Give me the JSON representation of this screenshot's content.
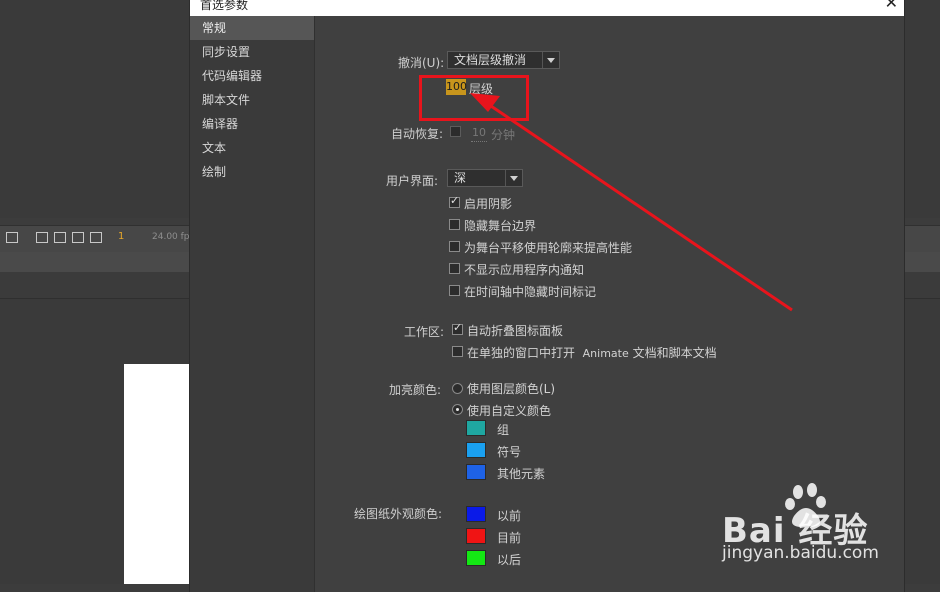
{
  "background_app": {
    "frame_number": "1",
    "fps": "24.00 fps"
  },
  "dialog": {
    "title": "首选参数",
    "sidebar": {
      "items": [
        {
          "label": "常规",
          "active": true
        },
        {
          "label": "同步设置"
        },
        {
          "label": "代码编辑器"
        },
        {
          "label": "脚本文件"
        },
        {
          "label": "编译器"
        },
        {
          "label": "文本"
        },
        {
          "label": "绘制"
        }
      ]
    },
    "undo": {
      "label": "撤消(U):",
      "value": "文档层级撤消",
      "levels_value": "100",
      "levels_unit": "层级"
    },
    "autorecover": {
      "label": "自动恢复:",
      "checked": false,
      "minutes_value": "10",
      "minutes_unit": "分钟"
    },
    "ui": {
      "label": "用户界面:",
      "value": "深",
      "options": [
        {
          "label": "启用阴影",
          "checked": true
        },
        {
          "label": "隐藏舞台边界",
          "checked": false
        },
        {
          "label": "为舞台平移使用轮廓来提高性能",
          "checked": false
        },
        {
          "label": "不显示应用程序内通知",
          "checked": false
        },
        {
          "label": "在时间轴中隐藏时间标记",
          "checked": false
        }
      ]
    },
    "workspace": {
      "label": "工作区:",
      "options": [
        {
          "label": "自动折叠图标面板",
          "checked": true
        },
        {
          "label": "在单独的窗口中打开",
          "label_app": "Animate",
          "label_tail": "文档和脚本文档",
          "checked": false
        }
      ]
    },
    "highlight_color": {
      "label": "加亮颜色:",
      "radio_layer": "使用图层颜色(L)",
      "radio_custom": "使用自定义颜色",
      "swatches": [
        {
          "label": "组",
          "color": "#1fa7a1"
        },
        {
          "label": "符号",
          "color": "#1aa0f0"
        },
        {
          "label": "其他元素",
          "color": "#1e62e6"
        }
      ]
    },
    "onion_skin": {
      "label": "绘图纸外观颜色:",
      "swatches": [
        {
          "label": "以前",
          "color": "#0a1ae8"
        },
        {
          "label": "目前",
          "color": "#f01414"
        },
        {
          "label": "以后",
          "color": "#14e814"
        }
      ]
    }
  },
  "watermark": {
    "brand": "Bai  经验",
    "url": "jingyan.baidu.com"
  }
}
